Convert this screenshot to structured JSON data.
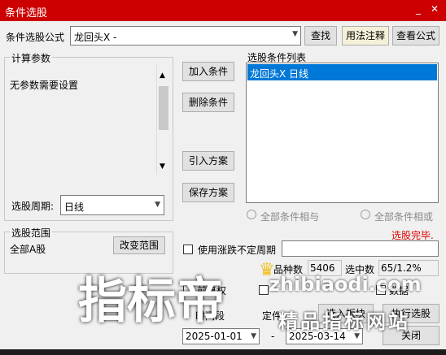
{
  "window": {
    "title": "条件选股",
    "close_glyph": "✕"
  },
  "formula": {
    "label": "条件选股公式",
    "value": "龙回头X  -",
    "find": "查找",
    "usage": "用法注释",
    "view": "查看公式"
  },
  "params": {
    "title": "计算参数",
    "text": "无参数需要设置",
    "period_label": "选股周期:",
    "period_value": "日线"
  },
  "actions": {
    "add": "加入条件",
    "delete": "删除条件",
    "import": "引入方案",
    "save": "保存方案"
  },
  "conditions": {
    "title": "选股条件列表",
    "items": [
      "龙回头X  日线"
    ],
    "and_label": "全部条件相与",
    "or_label": "全部条件相或"
  },
  "status": {
    "done": "选股完毕.",
    "count_label": "品种数",
    "count_value": "5406",
    "hit_label": "选中数",
    "hit_value": "65/1.2%"
  },
  "range": {
    "title": "选股范围",
    "value": "全部A股",
    "change": "改变范围",
    "uncertain_period": "使用涨跌不定周期"
  },
  "options": {
    "rights": "前复权",
    "mid": "数据",
    "time_label": "时间段",
    "cond_label": "定件"
  },
  "dates": {
    "start": "2025-01-01",
    "end": "2025-03-14",
    "sep": "-"
  },
  "bottom": {
    "select_board": "选入板块",
    "execute": "执行选股",
    "close": "关闭"
  },
  "watermark": {
    "big": "指标帝",
    "url": "zhibiaodi.com",
    "sub": "精品指标网站"
  },
  "colors": {
    "titlebar": "#cc0000",
    "selection": "#0078d7",
    "done": "#e00000"
  }
}
